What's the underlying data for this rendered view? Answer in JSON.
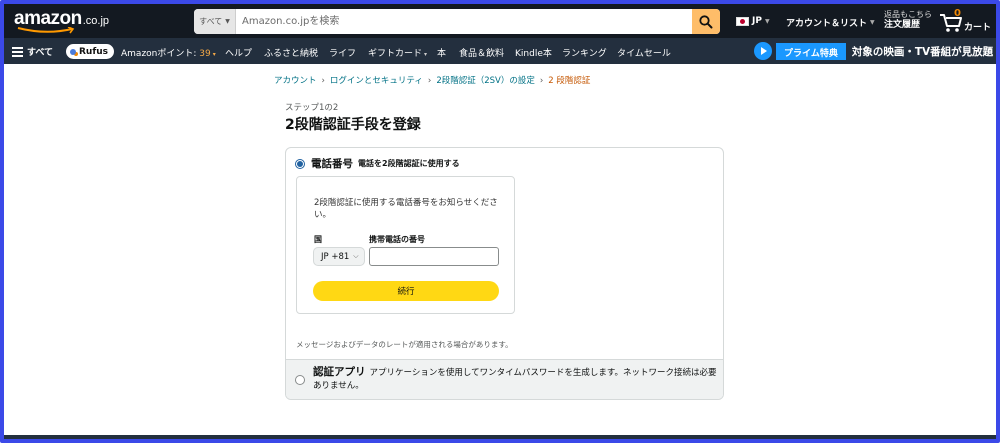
{
  "header": {
    "logo_text": "amazon",
    "logo_tld": ".co.jp",
    "search_category": "すべて",
    "search_placeholder": "Amazon.co.jpを検索",
    "language": "JP",
    "account_label": "アカウント＆リスト",
    "orders_line1": "返品もこちら",
    "orders_line2": "注文履歴",
    "cart_count": "0",
    "cart_label": "カート"
  },
  "nav": {
    "all": "すべて",
    "rufus": "Rufus",
    "points_label": "Amazonポイント: ",
    "points_value": "39",
    "items": [
      "ヘルプ",
      "ふるさと納税",
      "ライフ",
      "ギフトカード",
      "本",
      "食品＆飲料",
      "Kindle本",
      "ランキング",
      "タイムセール"
    ],
    "prime_tag": "プライム特典",
    "prime_text": "対象の映画・TV番組が見放題"
  },
  "breadcrumb": {
    "items": [
      "アカウント",
      "ログインとセキュリティ",
      "2段階認証（2SV）の設定"
    ],
    "current": "2 段階認証"
  },
  "page": {
    "step": "ステップ1の2",
    "title": "2段階認証手段を登録"
  },
  "option_phone": {
    "label": "電話番号",
    "sublabel": "電話を2段階認証に使用する",
    "description": "2段階認証に使用する電話番号をお知らせください。",
    "country_label": "国",
    "phone_label": "携帯電話の番号",
    "country_value": "JP +81",
    "phone_value": "",
    "continue_label": "続行",
    "notice": "メッセージおよびデータのレートが適用される場合があります。"
  },
  "option_app": {
    "label": "認証アプリ",
    "description": "アプリケーションを使用してワンタイムパスワードを生成します。ネットワーク接続は必要ありません。"
  },
  "colors": {
    "header_bg": "#131921",
    "nav_bg": "#232f3e",
    "search_button": "#febd69",
    "continue_button": "#ffd814",
    "link": "#007185",
    "breadcrumb_current": "#c45500",
    "prime_blue": "#1a98ff",
    "frame_border": "#3b49e8"
  }
}
